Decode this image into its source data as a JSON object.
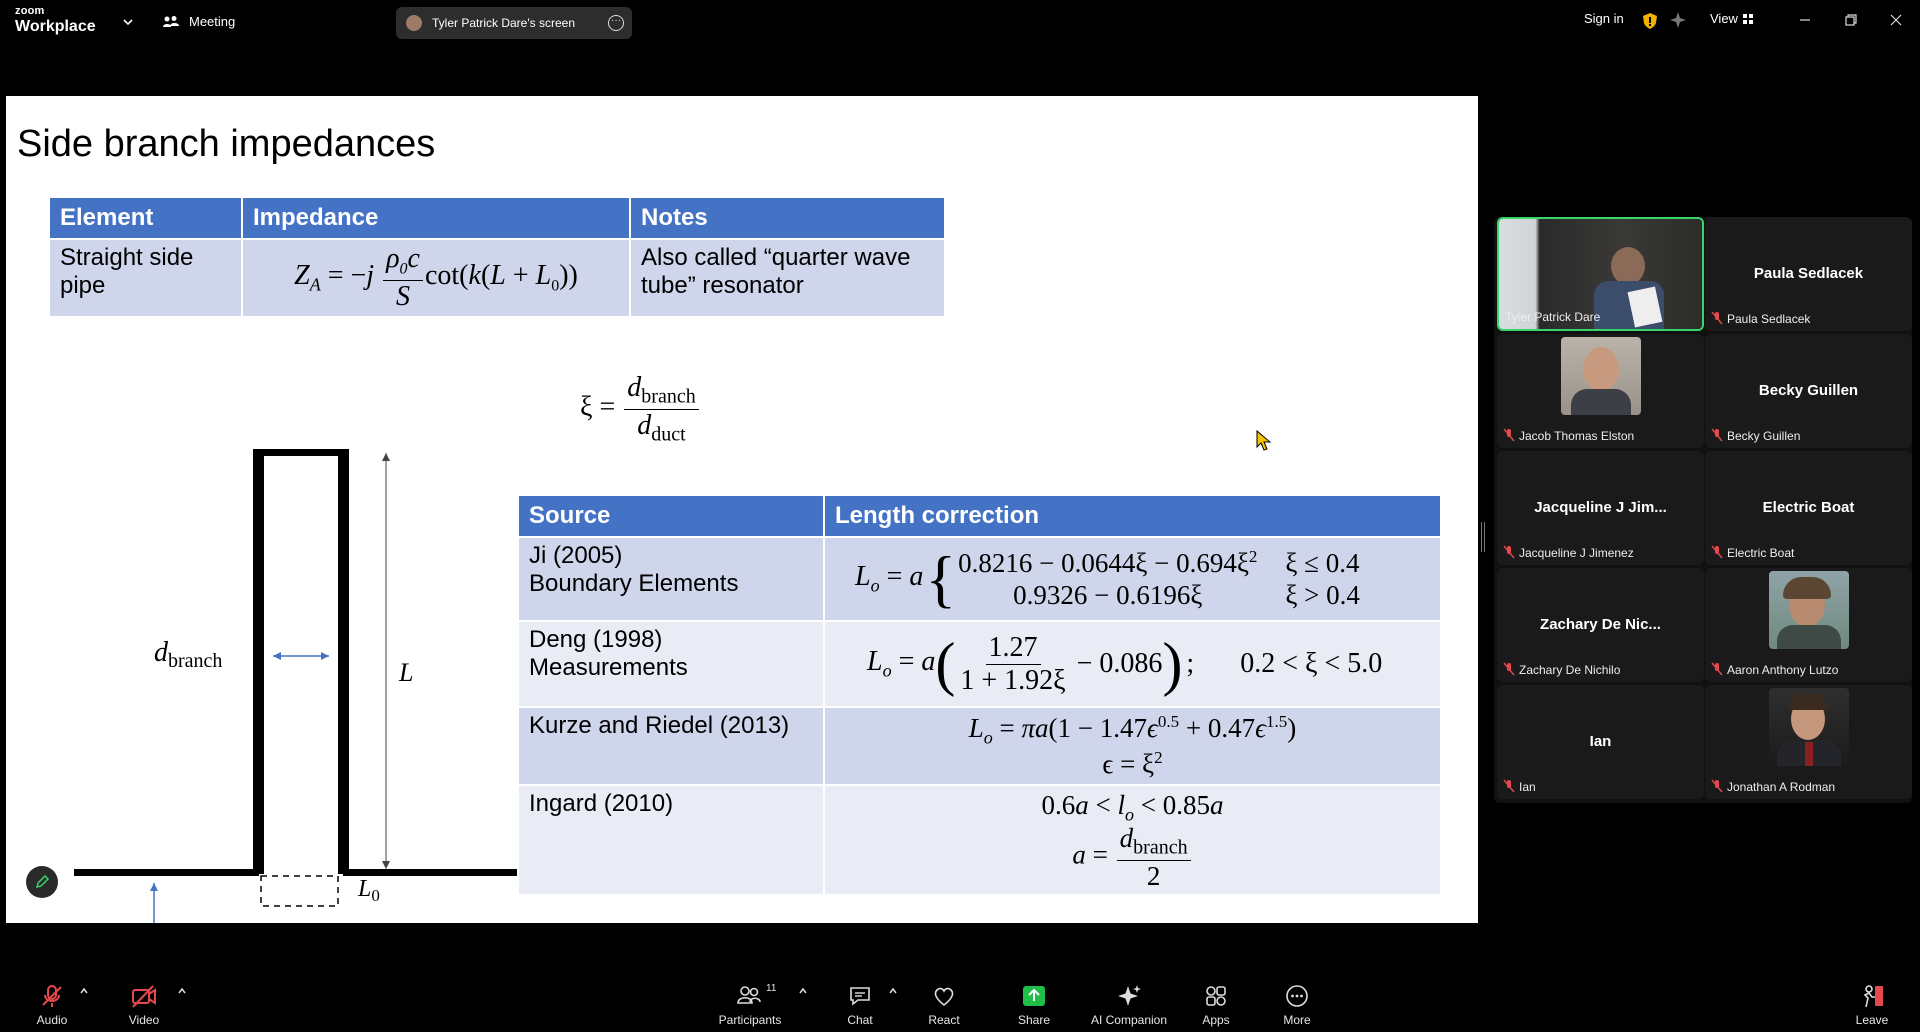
{
  "topbar": {
    "logo_line1": "zoom",
    "logo_line2": "Workplace",
    "meeting_label": "Meeting",
    "share_indicator": "Tyler Patrick Dare's screen",
    "sign_in": "Sign in",
    "view_label": "View"
  },
  "slide": {
    "title": "Side branch impedances",
    "table1": {
      "headers": [
        "Element",
        "Impedance",
        "Notes"
      ],
      "row": {
        "element": "Straight side pipe",
        "notes": "Also called “quarter wave tube” resonator"
      }
    },
    "diagram": {
      "label_d_branch_sub": "branch",
      "label_L": "L",
      "label_L0": "L",
      "label_L0_sub": "0",
      "label_d_duct_sub": "duct"
    },
    "xi_def": {
      "lhs": "ξ =",
      "num_sub": "branch",
      "den_sub": "duct"
    },
    "table2": {
      "headers": [
        "Source",
        "Length correction"
      ],
      "rows": [
        {
          "source_line1": "Ji (2005)",
          "source_line2": "Boundary Elements"
        },
        {
          "source_line1": "Deng (1998)",
          "source_line2": "Measurements"
        },
        {
          "source_line1": "Kurze and Riedel (2013)",
          "source_line2": ""
        },
        {
          "source_line1": "Ingard (2010)",
          "source_line2": ""
        }
      ],
      "ji_case1": "0.8216 − 0.0644ξ − 0.694ξ",
      "ji_case1_cond": "ξ ≤ 0.4",
      "ji_case2": "0.9326 − 0.6196ξ",
      "ji_case2_cond": "ξ > 0.4",
      "deng_num": "1.27",
      "deng_den": "1 + 1.92ξ",
      "deng_tail": "− 0.086",
      "deng_cond": "0.2 < ξ < 5.0",
      "kurze_line2": "ϵ = ξ",
      "ingard_line1_a": "0.6",
      "ingard_line1_b": " < ",
      "ingard_line1_c": " < 0.85",
      "ingard_den": "2"
    }
  },
  "participants": [
    {
      "name": "Tyler Patrick Dare",
      "video": true,
      "active": true
    },
    {
      "name": "Paula Sedlacek",
      "display": "Paula Sedlacek",
      "video": false
    },
    {
      "name": "Jacob Thomas Elston",
      "video": true
    },
    {
      "name": "Becky Guillen",
      "display": "Becky Guillen",
      "video": false
    },
    {
      "name": "Jacqueline J Jimenez",
      "display": "Jacqueline J Jim...",
      "video": false
    },
    {
      "name": "Electric Boat",
      "display": "Electric Boat",
      "video": false
    },
    {
      "name": "Zachary De Nichilo",
      "display": "Zachary De Nic...",
      "video": false
    },
    {
      "name": "Aaron Anthony Lutzo",
      "video": true
    },
    {
      "name": "Ian",
      "display": "Ian",
      "video": false
    },
    {
      "name": "Jonathan A Rodman",
      "video": true
    }
  ],
  "toolbar": {
    "audio": "Audio",
    "video": "Video",
    "participants": "Participants",
    "participants_count": "11",
    "chat": "Chat",
    "react": "React",
    "share": "Share",
    "ai_companion": "AI Companion",
    "apps": "Apps",
    "more": "More",
    "leave": "Leave"
  },
  "colors": {
    "table_header": "#4472c4",
    "row_dark": "#cfd5ea",
    "row_light": "#e9ebf5",
    "active_border": "#36d66a",
    "share_green": "#1fbe48",
    "muted_red": "#e5484d"
  }
}
